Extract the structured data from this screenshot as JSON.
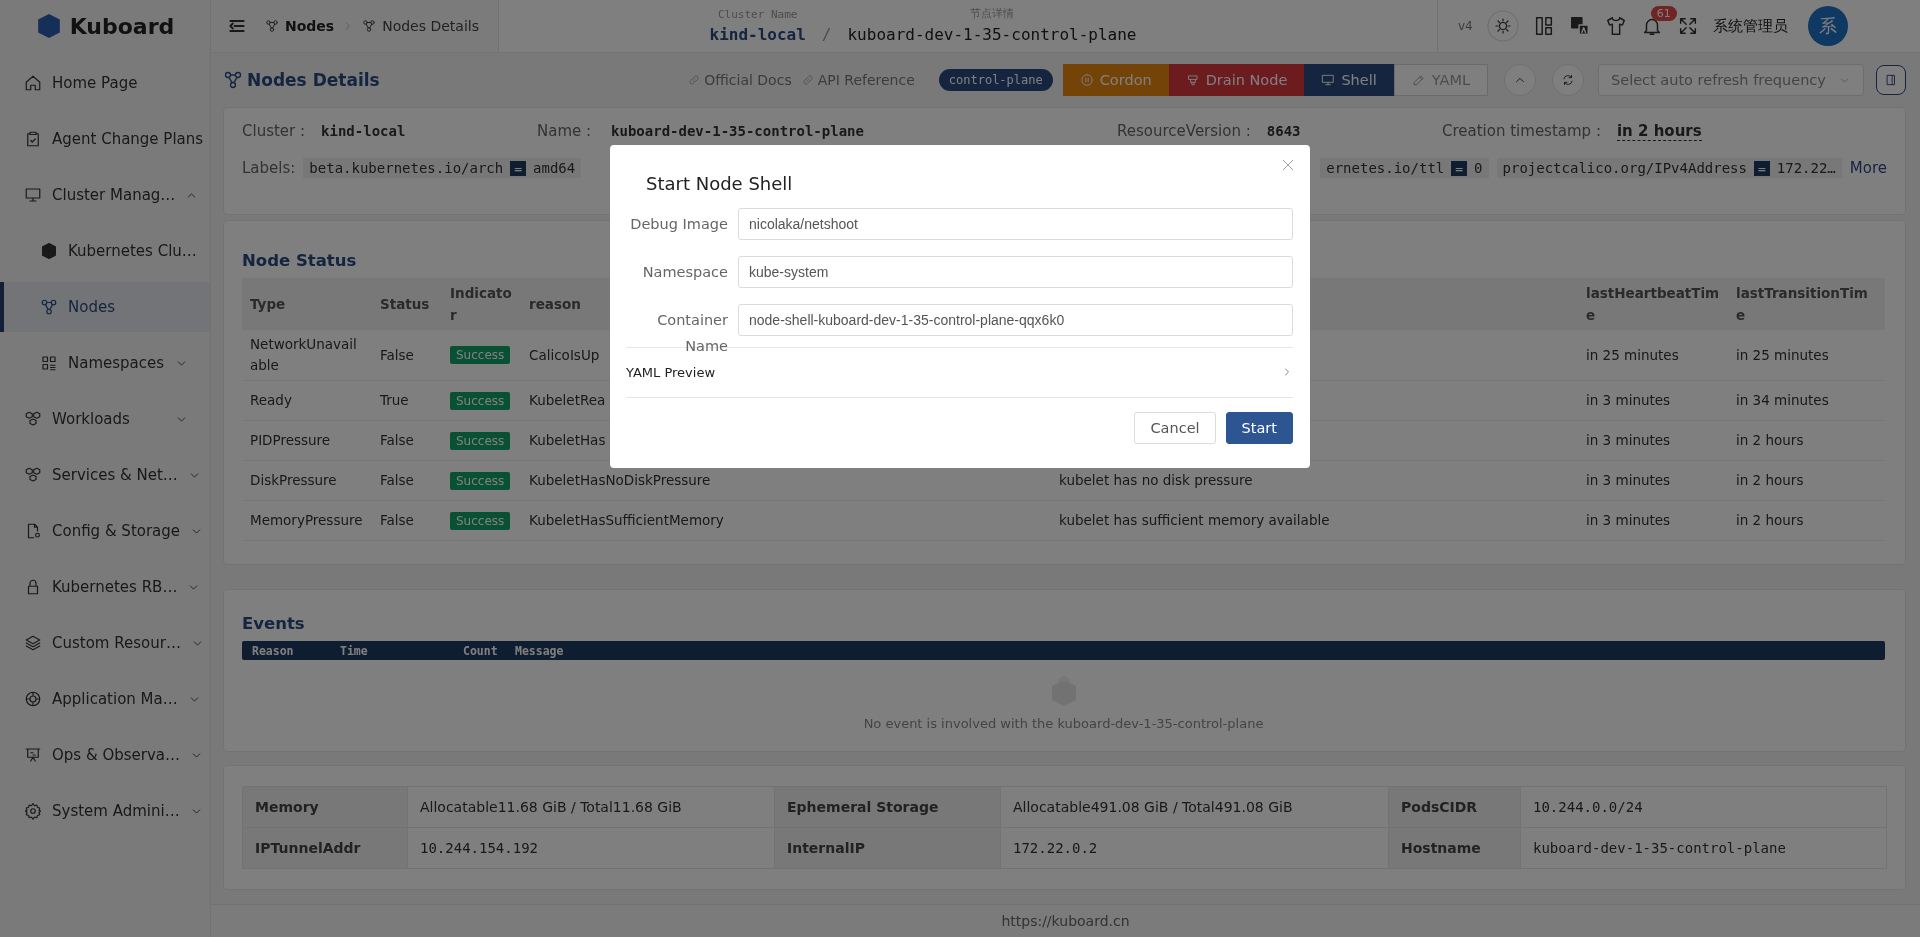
{
  "sidebar": {
    "logo": "Kuboard",
    "items": [
      {
        "label": "Home Page",
        "selected": false
      },
      {
        "label": "Agent Change Plans",
        "selected": false
      },
      {
        "label": "Cluster Manag…",
        "selected": false,
        "expanded": true,
        "children": [
          {
            "label": "Kubernetes Clu…",
            "selected": false
          },
          {
            "label": "Nodes",
            "selected": true
          },
          {
            "label": "Namespaces",
            "selected": false,
            "expanded": false
          }
        ]
      },
      {
        "label": "Workloads",
        "selected": false,
        "expanded": false
      },
      {
        "label": "Services & Net…",
        "selected": false,
        "expanded": false
      },
      {
        "label": "Config & Storage",
        "selected": false,
        "expanded": false
      },
      {
        "label": "Kubernetes RB…",
        "selected": false,
        "expanded": false
      },
      {
        "label": "Custom Resour…",
        "selected": false,
        "expanded": false
      },
      {
        "label": "Application Ma…",
        "selected": false,
        "expanded": false
      },
      {
        "label": "Ops & Observa…",
        "selected": false,
        "expanded": false
      },
      {
        "label": "System Admini…",
        "selected": false,
        "expanded": false
      }
    ]
  },
  "header": {
    "breadcrumb": [
      "Nodes",
      "Nodes Details"
    ],
    "cluster": {
      "label": "Cluster Name",
      "value": "kind-local"
    },
    "separator": "/",
    "node": {
      "label": "节点详情",
      "value": "kuboard-dev-1-35-control-plane"
    },
    "version": "v4",
    "notification_count": "61",
    "user": "系统管理员",
    "avatar": "系"
  },
  "page": {
    "title": "Nodes Details",
    "links": [
      "Official Docs",
      "API Reference"
    ],
    "role": "control-plane",
    "actions": [
      {
        "label": "Cordon",
        "kind": "warning"
      },
      {
        "label": "Drain Node",
        "kind": "danger"
      },
      {
        "label": "Shell",
        "kind": "primary"
      },
      {
        "label": "YAML",
        "kind": "plain"
      }
    ],
    "refresh": {
      "placeholder": "Select auto refresh frequency"
    }
  },
  "info": {
    "fields": [
      {
        "label": "Cluster :",
        "value": "kind-local"
      },
      {
        "label": "Name :",
        "value": "kuboard-dev-1-35-control-plane"
      },
      {
        "label": "ResourceVersion :",
        "value": "8643"
      },
      {
        "label": "Creation timestamp :",
        "value": "in 2 hours"
      }
    ],
    "labels_title": "Labels:",
    "labels_left": [
      {
        "key": "beta.kubernetes.io/arch",
        "eq": "=",
        "value": "amd64"
      }
    ],
    "labels_right": [
      {
        "key": "ernetes.io/ttl",
        "eq": "=",
        "value": "0"
      },
      {
        "key": "projectcalico.org/IPv4Address",
        "eq": "=",
        "value": "172.22…"
      }
    ],
    "more": "More"
  },
  "node_status": {
    "title": "Node Status",
    "columns": {
      "type": "Type",
      "status": "Status",
      "indicator": "Indicator",
      "reason": "reason",
      "last_heartbeat": "lastHeartbeatTime",
      "last_transition": "lastTransitionTime"
    },
    "rows": [
      {
        "type": "NetworkUnavailable",
        "status": "False",
        "indicator": "Success",
        "reason": "CalicoIsUp",
        "last_heartbeat": "in 25 minutes",
        "last_transition": "in 25 minutes"
      },
      {
        "type": "Ready",
        "status": "True",
        "indicator": "Success",
        "reason": "KubeletRea",
        "last_heartbeat": "in 3 minutes",
        "last_transition": "in 34 minutes"
      },
      {
        "type": "PIDPressure",
        "status": "False",
        "indicator": "Success",
        "reason": "KubeletHas",
        "last_heartbeat": "in 3 minutes",
        "last_transition": "in 2 hours"
      },
      {
        "type": "DiskPressure",
        "status": "False",
        "indicator": "Success",
        "reason": "KubeletHasNoDiskPressure",
        "message": "kubelet has no disk pressure",
        "last_heartbeat": "in 3 minutes",
        "last_transition": "in 2 hours"
      },
      {
        "type": "MemoryPressure",
        "status": "False",
        "indicator": "Success",
        "reason": "KubeletHasSufficientMemory",
        "message": "kubelet has sufficient memory available",
        "last_heartbeat": "in 3 minutes",
        "last_transition": "in 2 hours"
      }
    ]
  },
  "events": {
    "title": "Events",
    "columns": [
      "Reason",
      "Time",
      "Count",
      "Message"
    ],
    "empty_text": "No event is involved with the kuboard-dev-1-35-control-plane"
  },
  "resources": [
    [
      {
        "label": "Memory",
        "value": "Allocatable11.68 GiB / Total11.68 GiB",
        "kind": "text"
      },
      {
        "label": "Ephemeral Storage",
        "value": "Allocatable491.08 GiB / Total491.08 GiB",
        "kind": "text"
      },
      {
        "label": "PodsCIDR",
        "value": "10.244.0.0/24",
        "kind": "mono"
      }
    ],
    [
      {
        "label": "IPTunnelAddr",
        "value": "10.244.154.192",
        "kind": "mono"
      },
      {
        "label": "InternalIP",
        "value": "172.22.0.2",
        "kind": "mono"
      },
      {
        "label": "Hostname",
        "value": "kuboard-dev-1-35-control-plane",
        "kind": "mono"
      }
    ]
  ],
  "footer": "https://kuboard.cn",
  "modal": {
    "title": "Start Node Shell",
    "fields": [
      {
        "label": "Debug Image",
        "value": "nicolaka/netshoot"
      },
      {
        "label": "Namespace",
        "value": "kube-system"
      },
      {
        "label": "Container Name",
        "value": "node-shell-kuboard-dev-1-35-control-plane-qqx6k0"
      }
    ],
    "yaml_preview": {
      "label": "YAML Preview",
      "expanded": false
    },
    "buttons": [
      {
        "label": "Cancel",
        "kind": "default"
      },
      {
        "label": "Start",
        "kind": "primary"
      }
    ]
  }
}
